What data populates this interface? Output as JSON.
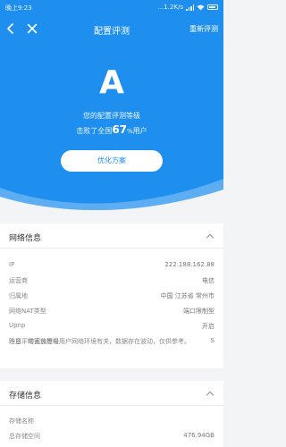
{
  "status_bar": {
    "time": "晚上9:23",
    "network_speed": "...1.2K/s",
    "battery_icon": "battery-icon",
    "wifi_icon": "wifi-icon",
    "signal_icon": "signal-icon"
  },
  "header": {
    "title": "配置评测",
    "retest_label": "重新评测",
    "back_icon": "chevron-left-icon",
    "close_icon": "close-icon"
  },
  "result": {
    "grade": "A",
    "grade_label": "您的配置评测等级",
    "beat_prefix": "击败了全国",
    "beat_percent": "67",
    "beat_percent_unit": "%",
    "beat_suffix": "用户",
    "optimize_button": "优化方案"
  },
  "network_info": {
    "title": "网络信息",
    "rows": [
      {
        "label": "IP",
        "value": "222.188.162.88"
      },
      {
        "label": "运营商",
        "value": "电信"
      },
      {
        "label": "归属地",
        "value": "中国 江苏省 常州市"
      },
      {
        "label": "网络NAT类型",
        "value": "端口限制型"
      },
      {
        "label": "Upnp",
        "value": "开启"
      },
      {
        "label": "昨日平均丢包等级",
        "value": "S"
      }
    ],
    "note": "注意：带宽速度与用户网络环境有关，数据存在波动，仅供参考。"
  },
  "storage_info": {
    "title": "存储信息",
    "rows": [
      {
        "label": "存储名称",
        "value": ""
      },
      {
        "label": "总存储空间",
        "value": "476.94GB"
      }
    ]
  },
  "colors": {
    "primary": "#1e8fee",
    "background": "#f3f4f6",
    "panel": "#ffffff"
  }
}
